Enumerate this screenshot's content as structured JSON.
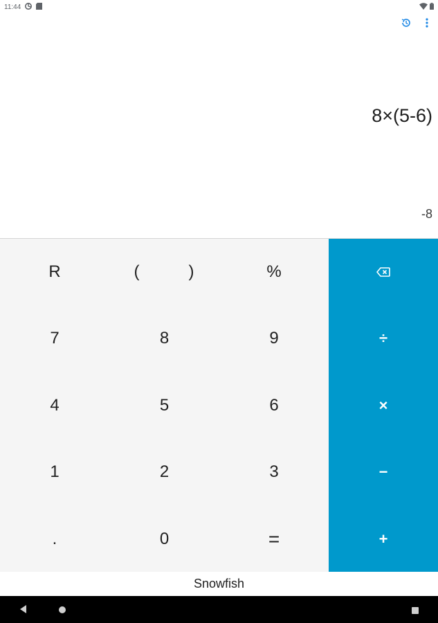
{
  "status_bar": {
    "time": "11:44",
    "icons": [
      "settings-gear-icon",
      "sd-card-icon",
      "wifi-icon",
      "battery-icon"
    ]
  },
  "app_bar": {
    "history_icon": "history-icon",
    "menu_icon": "more-vert-icon"
  },
  "display": {
    "expression": "8×(5-6)",
    "result": "-8"
  },
  "keypad": {
    "r_label": "R",
    "open_paren": "(",
    "close_paren": ")",
    "percent": "%",
    "seven": "7",
    "eight": "8",
    "nine": "9",
    "four": "4",
    "five": "5",
    "six": "6",
    "one": "1",
    "two": "2",
    "three": "3",
    "decimal": ".",
    "zero": "0",
    "equals": "=",
    "backspace_icon": "backspace-icon",
    "divide": "÷",
    "multiply": "×",
    "minus": "−",
    "plus": "+"
  },
  "app_label": "Snowfish",
  "colors": {
    "accent": "#0099cc",
    "keypad_bg": "#f5f5f5",
    "nav_bg": "#000000"
  }
}
